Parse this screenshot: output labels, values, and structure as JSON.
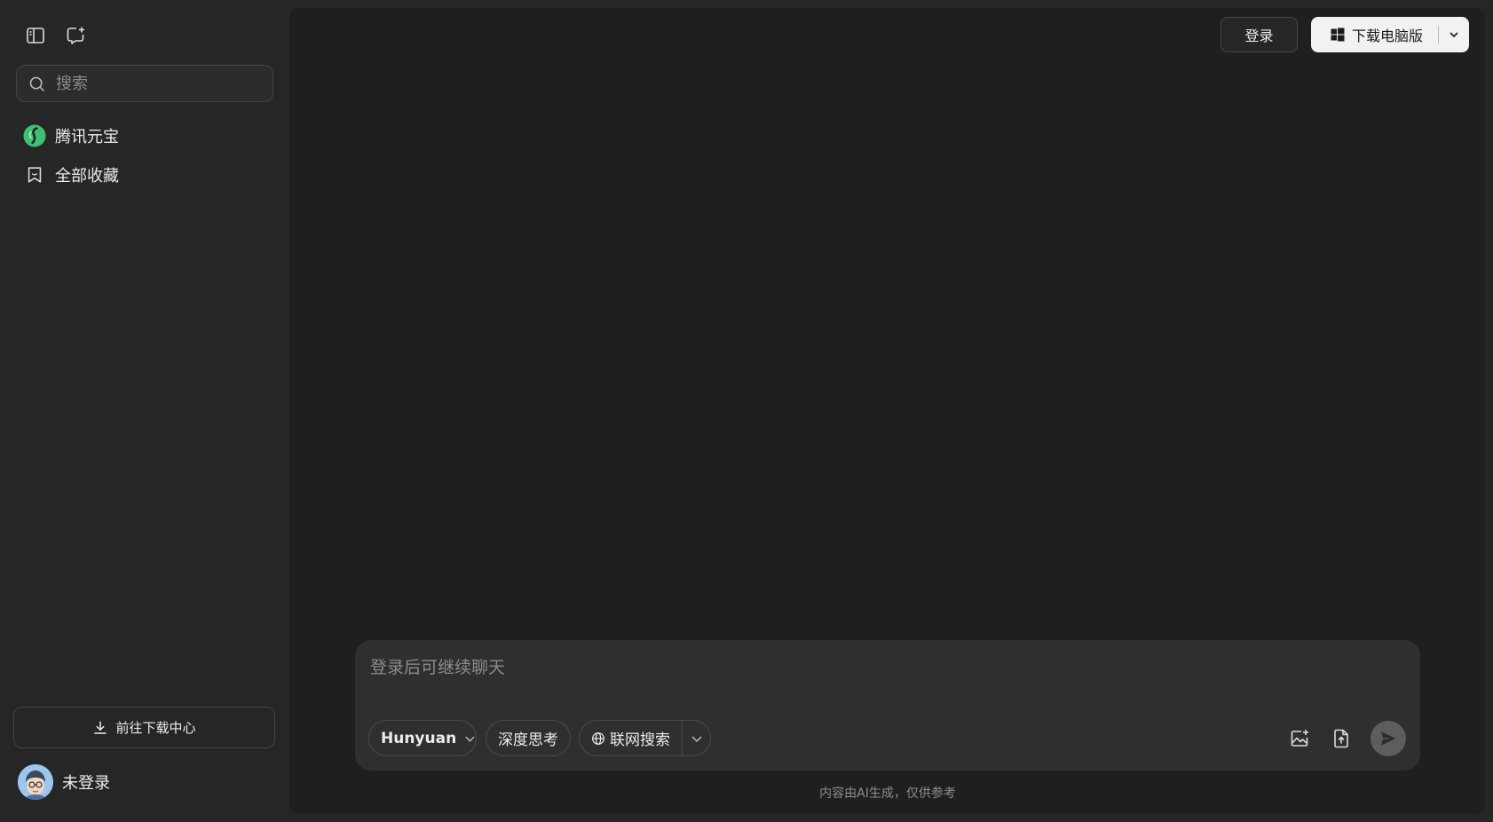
{
  "sidebar": {
    "toggle_icon": "sidebar-toggle-icon",
    "new_chat_icon": "new-chat-icon",
    "search": {
      "placeholder": "搜索",
      "value": ""
    },
    "items": [
      {
        "label": "腾讯元宝",
        "icon": "yuanbao-logo-icon"
      },
      {
        "label": "全部收藏",
        "icon": "bookmark-icon"
      }
    ],
    "download_center_label": "前往下载中心",
    "user": {
      "name": "未登录",
      "avatar": "cartoon-avatar"
    }
  },
  "header": {
    "login_label": "登录",
    "download_label": "下载电脑版",
    "download_icon": "windows-icon"
  },
  "composer": {
    "placeholder": "登录后可继续聊天",
    "value": "",
    "model_label": "Hunyuan",
    "deep_think_label": "深度思考",
    "web_search_label": "联网搜索"
  },
  "disclaimer": "内容由AI生成，仅供参考",
  "colors": {
    "background": "#262626",
    "main_panel": "#1f1f1f",
    "composer": "#2f2f2f",
    "brand_green": "#3fbf73",
    "download_button": "#f2f2f2"
  }
}
